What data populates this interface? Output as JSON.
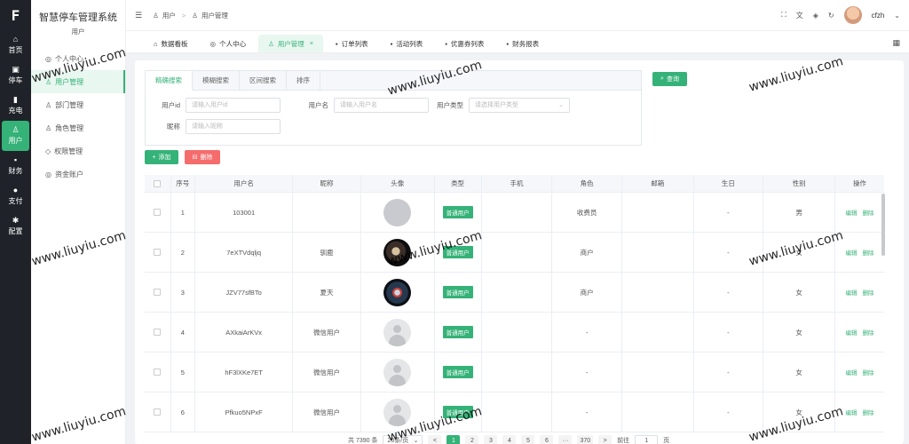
{
  "rail": {
    "logo": "F",
    "items": [
      {
        "label": "首页",
        "icon": "⌂"
      },
      {
        "label": "停车",
        "icon": "▣"
      },
      {
        "label": "充电",
        "icon": "▮"
      },
      {
        "label": "用户",
        "icon": "♙"
      },
      {
        "label": "财务",
        "icon": "▪"
      },
      {
        "label": "支付",
        "icon": "●"
      },
      {
        "label": "配置",
        "icon": "✱"
      }
    ]
  },
  "subside": {
    "title": "智慧停车管理系统",
    "subtitle": "用户",
    "items": [
      {
        "label": "个人中心",
        "icon": "◎"
      },
      {
        "label": "用户管理",
        "icon": "♙"
      },
      {
        "label": "部门管理",
        "icon": "♙"
      },
      {
        "label": "角色管理",
        "icon": "♙"
      },
      {
        "label": "权限管理",
        "icon": "◇"
      },
      {
        "label": "资金账户",
        "icon": "◎"
      }
    ]
  },
  "header": {
    "breadcrumb": [
      "用户",
      "用户管理"
    ],
    "username": "cfzh"
  },
  "tabs": [
    {
      "label": "数据看板",
      "icon": "⌂"
    },
    {
      "label": "个人中心",
      "icon": "◎"
    },
    {
      "label": "用户管理",
      "icon": "♙",
      "close": "×"
    },
    {
      "label": "订单列表",
      "icon": "▪"
    },
    {
      "label": "活动列表",
      "icon": "▪"
    },
    {
      "label": "优惠券列表",
      "icon": "▪"
    },
    {
      "label": "财务报表",
      "icon": "▪"
    }
  ],
  "filter": {
    "tabs": [
      "精确搜索",
      "模糊搜索",
      "区间搜索",
      "排序"
    ],
    "fields": {
      "userid_label": "用户id",
      "userid_placeholder": "请输入用户id",
      "username_label": "用户名",
      "username_placeholder": "请输入用户名",
      "usertype_label": "用户类型",
      "usertype_placeholder": "请选择用户类型",
      "nickname_label": "昵称",
      "nickname_placeholder": "请输入昵称"
    },
    "query_label": "查询"
  },
  "actions": {
    "add_label": "添加",
    "delete_label": "删除"
  },
  "table": {
    "headers": [
      "序号",
      "用户名",
      "昵称",
      "头像",
      "类型",
      "手机",
      "角色",
      "邮箱",
      "生日",
      "性别",
      "操作"
    ],
    "rows": [
      {
        "no": "1",
        "username": "103001",
        "nickname": "",
        "avatar": "gray",
        "type": "普通用户",
        "phone": "",
        "role": "收费员",
        "email": "",
        "birthday": "-",
        "gender": "男"
      },
      {
        "no": "2",
        "username": "7eXTVdqljq",
        "nickname": "驯鹿",
        "avatar": "dark1",
        "type": "普通用户",
        "phone": "",
        "role": "商户",
        "email": "",
        "birthday": "-",
        "gender": "女"
      },
      {
        "no": "3",
        "username": "JZV77sfBTo",
        "nickname": "夏天",
        "avatar": "dark2",
        "type": "普通用户",
        "phone": "",
        "role": "商户",
        "email": "",
        "birthday": "-",
        "gender": "女"
      },
      {
        "no": "4",
        "username": "AXkaiArKVx",
        "nickname": "微信用户",
        "avatar": "person",
        "type": "普通用户",
        "phone": "",
        "role": "-",
        "email": "",
        "birthday": "-",
        "gender": "女"
      },
      {
        "no": "5",
        "username": "hF3lXKe7ET",
        "nickname": "微信用户",
        "avatar": "person",
        "type": "普通用户",
        "phone": "",
        "role": "-",
        "email": "",
        "birthday": "-",
        "gender": "女"
      },
      {
        "no": "6",
        "username": "Pfkuo5NPxF",
        "nickname": "微信用户",
        "avatar": "person",
        "type": "普通用户",
        "phone": "",
        "role": "-",
        "email": "",
        "birthday": "-",
        "gender": "女"
      }
    ],
    "op_edit": "编辑",
    "op_delete": "删除"
  },
  "pager": {
    "total": "共 7390 条",
    "size": "20条/页",
    "prev": "<",
    "next": ">",
    "pages": [
      "1",
      "2",
      "3",
      "4",
      "5",
      "6",
      "···",
      "370"
    ],
    "goto_label": "前往",
    "goto_value": "1",
    "page_suffix": "页"
  },
  "watermark": "www.liuyiu.com",
  "colors": {
    "accent": "#35b278",
    "danger": "#f56c6c",
    "rail": "#1f2329"
  }
}
